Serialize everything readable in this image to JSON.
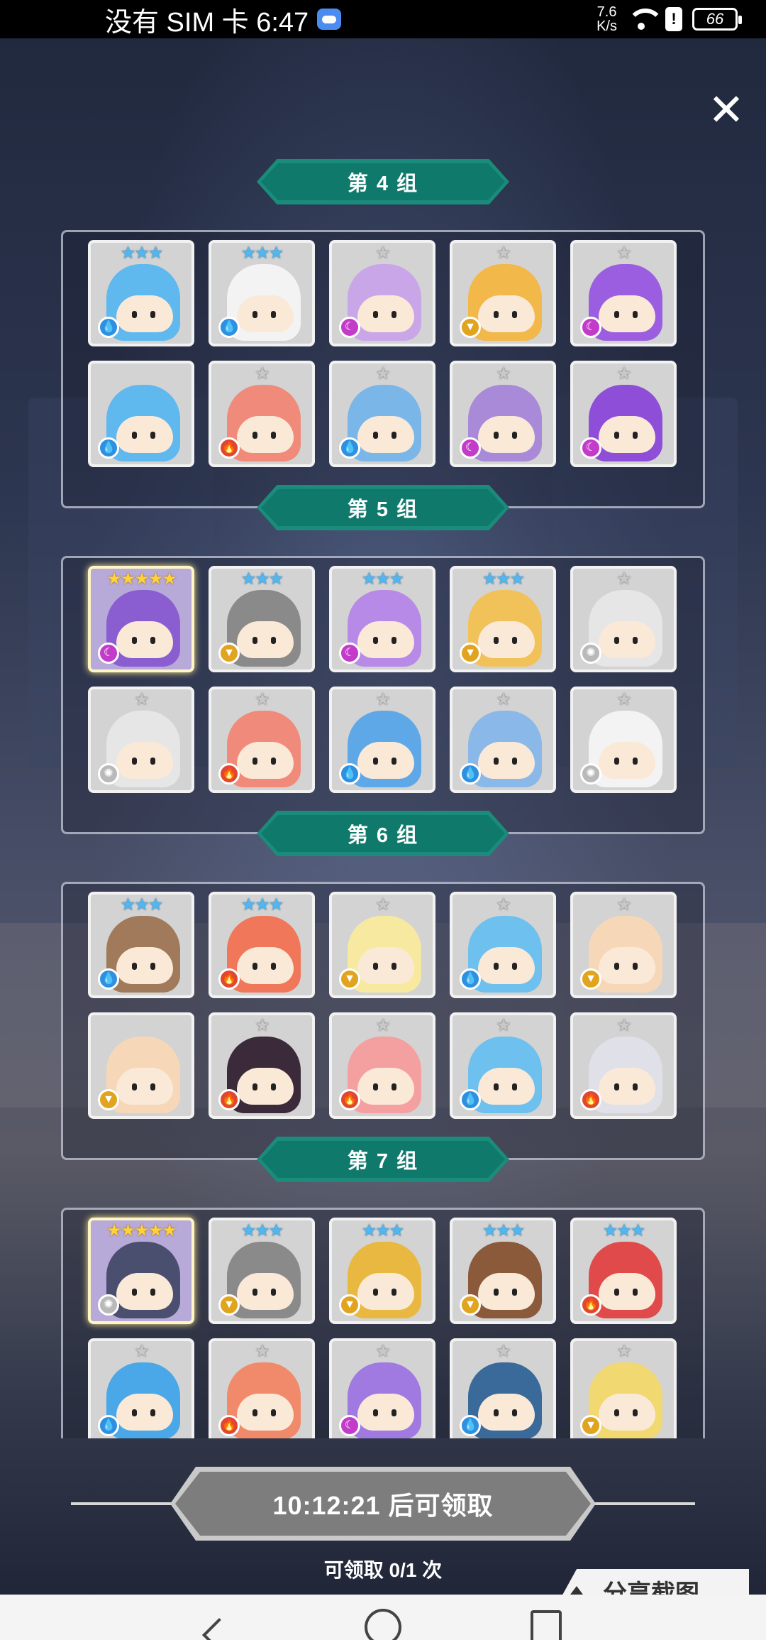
{
  "status_bar": {
    "carrier_time": "没有 SIM 卡 6:47",
    "net_speed_value": "7.6",
    "net_speed_unit": "K/s",
    "battery": "66"
  },
  "groups": [
    {
      "label": "第 4 组",
      "characters": [
        {
          "stars": "★★★",
          "rarity": "three",
          "element": "water",
          "color": "#5fb8ee"
        },
        {
          "stars": "★★★",
          "rarity": "three",
          "element": "water",
          "color": "#f3f3f3"
        },
        {
          "stars": "★",
          "rarity": "one",
          "element": "dark",
          "color": "#c9a6e8"
        },
        {
          "stars": "★",
          "rarity": "one",
          "element": "earth",
          "color": "#f2b84a"
        },
        {
          "stars": "★",
          "rarity": "one",
          "element": "dark",
          "color": "#9b5ee0"
        },
        {
          "stars": "",
          "rarity": "one",
          "element": "water",
          "color": "#5fb8ee"
        },
        {
          "stars": "★",
          "rarity": "one",
          "element": "fire",
          "color": "#f08a7a"
        },
        {
          "stars": "★",
          "rarity": "one",
          "element": "water",
          "color": "#7ab7e8"
        },
        {
          "stars": "★",
          "rarity": "one",
          "element": "dark",
          "color": "#a88ad8"
        },
        {
          "stars": "★",
          "rarity": "one",
          "element": "dark",
          "color": "#8e4ed8"
        }
      ]
    },
    {
      "label": "第 5 组",
      "characters": [
        {
          "stars": "★★★★★",
          "rarity": "five",
          "element": "dark",
          "color": "#8a5ed0"
        },
        {
          "stars": "★★★",
          "rarity": "three",
          "element": "earth",
          "color": "#8a8a8a"
        },
        {
          "stars": "★★★",
          "rarity": "three",
          "element": "dark",
          "color": "#b78ae8"
        },
        {
          "stars": "★★★",
          "rarity": "three",
          "element": "earth",
          "color": "#f2c25a"
        },
        {
          "stars": "★",
          "rarity": "one",
          "element": "light",
          "color": "#e6e6e6"
        },
        {
          "stars": "★",
          "rarity": "one",
          "element": "light",
          "color": "#e6e6e6"
        },
        {
          "stars": "★",
          "rarity": "one",
          "element": "fire",
          "color": "#f08a7a"
        },
        {
          "stars": "★",
          "rarity": "one",
          "element": "water",
          "color": "#5fa8e8"
        },
        {
          "stars": "★",
          "rarity": "one",
          "element": "water",
          "color": "#8ab8e8"
        },
        {
          "stars": "★",
          "rarity": "one",
          "element": "light",
          "color": "#f3f3f3"
        }
      ]
    },
    {
      "label": "第 6 组",
      "characters": [
        {
          "stars": "★★★",
          "rarity": "three",
          "element": "water",
          "color": "#a07a5a"
        },
        {
          "stars": "★★★",
          "rarity": "three",
          "element": "fire",
          "color": "#f0775a"
        },
        {
          "stars": "★",
          "rarity": "one",
          "element": "earth",
          "color": "#f7eaa0"
        },
        {
          "stars": "★",
          "rarity": "one",
          "element": "water",
          "color": "#6ec0ee"
        },
        {
          "stars": "★",
          "rarity": "one",
          "element": "earth",
          "color": "#f6d8b8"
        },
        {
          "stars": "",
          "rarity": "one",
          "element": "earth",
          "color": "#f6d8b8"
        },
        {
          "stars": "★",
          "rarity": "one",
          "element": "fire",
          "color": "#3a2a3a"
        },
        {
          "stars": "★",
          "rarity": "one",
          "element": "fire",
          "color": "#f5a0a0"
        },
        {
          "stars": "★",
          "rarity": "one",
          "element": "water",
          "color": "#6ec0ee"
        },
        {
          "stars": "★",
          "rarity": "one",
          "element": "fire",
          "color": "#e0e0e8"
        }
      ]
    },
    {
      "label": "第 7 组",
      "characters": [
        {
          "stars": "★★★★★",
          "rarity": "five",
          "element": "light",
          "color": "#4a4f70"
        },
        {
          "stars": "★★★",
          "rarity": "three",
          "element": "earth",
          "color": "#8a8a8a"
        },
        {
          "stars": "★★★",
          "rarity": "three",
          "element": "earth",
          "color": "#e8b840"
        },
        {
          "stars": "★★★",
          "rarity": "three",
          "element": "earth",
          "color": "#8a5a3a"
        },
        {
          "stars": "★★★",
          "rarity": "three",
          "element": "fire",
          "color": "#e04a4a"
        },
        {
          "stars": "★",
          "rarity": "one",
          "element": "water",
          "color": "#4aa8e8"
        },
        {
          "stars": "★",
          "rarity": "one",
          "element": "fire",
          "color": "#f08a6a"
        },
        {
          "stars": "★",
          "rarity": "one",
          "element": "dark",
          "color": "#a07ae0"
        },
        {
          "stars": "★",
          "rarity": "one",
          "element": "water",
          "color": "#3a6a9a"
        },
        {
          "stars": "★",
          "rarity": "one",
          "element": "earth",
          "color": "#f2d870"
        }
      ]
    }
  ],
  "claim": {
    "button_label": "10:12:21 后可领取",
    "count_text": "可领取 0/1 次"
  },
  "share": {
    "label": "分享截图"
  },
  "element_icons": {
    "water": "💧",
    "fire": "🔥",
    "dark": "☾",
    "earth": "▼",
    "light": "✺"
  }
}
